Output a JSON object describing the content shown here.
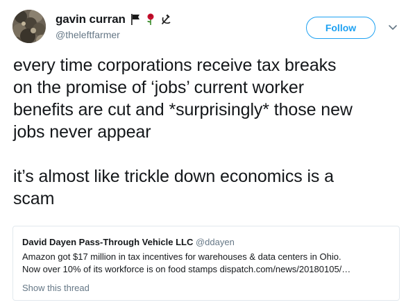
{
  "author": {
    "display_name": "gavin curran",
    "handle": "@theleftfarmer",
    "name_emojis": [
      "black-flag-icon",
      "rose-icon",
      "hammer-sickle-icon"
    ]
  },
  "follow_label": "Follow",
  "tweet": {
    "lines": [
      "every time corporations receive tax breaks",
      "on the promise of ‘jobs’ current worker",
      "benefits are cut and *surprisingly* those new",
      "jobs never appear",
      "",
      "it’s almost like trickle down economics is a",
      "scam"
    ]
  },
  "quoted": {
    "name": "David Dayen Pass-Through Vehicle LLC",
    "handle": "@ddayen",
    "lines": [
      "Amazon got $17 million in tax incentives for warehouses & data centers in Ohio.",
      "Now over 10% of its workforce is on food stamps dispatch.com/news/20180105/…"
    ],
    "show_thread": "Show this thread"
  },
  "colors": {
    "accent": "#1da1f2",
    "text": "#14171a",
    "muted": "#657786",
    "border": "#e1e8ed"
  }
}
